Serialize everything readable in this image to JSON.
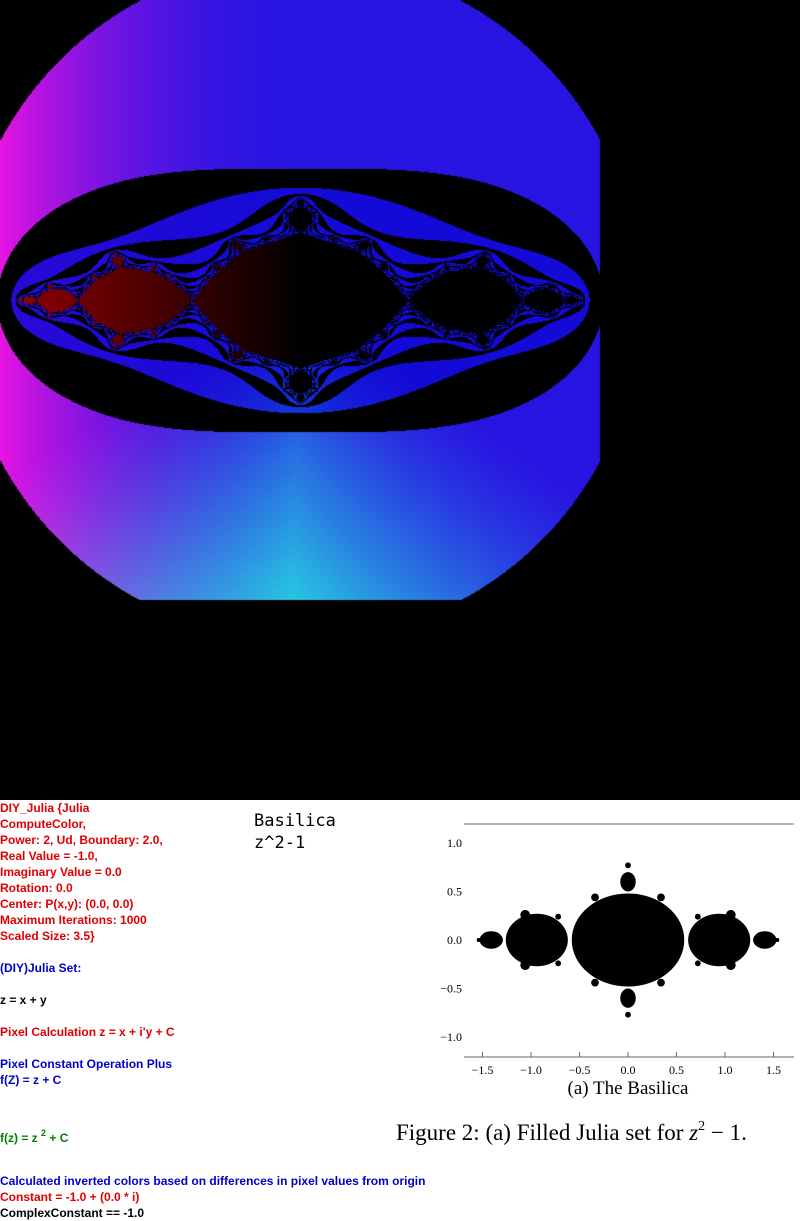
{
  "render": {
    "real": -1.0,
    "imaginary": 0.0,
    "max_iterations": 1000,
    "boundary": 2.0
  },
  "info": {
    "block1": [
      "DIY_Julia {Julia",
      "ComputeColor,",
      "Power: 2, Ud, Boundary: 2.0,",
      "Real Value = -1.0,",
      "Imaginary Value = 0.0",
      "Rotation: 0.0",
      "Center: P(x,y): (0.0, 0.0)",
      "Maximum Iterations: 1000",
      "Scaled Size: 3.5}"
    ],
    "julia_set_label": "(DIY)Julia Set:",
    "z_formula": "z = x + y",
    "pixel_calc": "Pixel Calculation z = x + i'y + C",
    "pixel_constant_op": "Pixel Constant Operation Plus",
    "fz": "f(Z) = z + C",
    "fz2_prefix": "f(z) = z ",
    "fz2_exp": "2",
    "fz2_suffix": " + C",
    "inverted_colors": "Calculated inverted colors based on differences in pixel values from origin",
    "constant": "Constant = -1.0 + (0.0 * i)",
    "complex_constant": "ComplexConstant == -1.0"
  },
  "title": {
    "name": "Basilica",
    "formula": "z^2-1"
  },
  "plot": {
    "x_ticks": [
      "−1.5",
      "−1.0",
      "−0.5",
      "0.0",
      "0.5",
      "1.0",
      "1.5"
    ],
    "y_ticks": [
      "1.0",
      "0.5",
      "0.0",
      "−0.5",
      "−1.0"
    ],
    "caption": "(a) The Basilica"
  },
  "figure_caption": {
    "text": "Figure 2: (a) Filled Julia set for ",
    "math_z": "z",
    "math_exp": "2",
    "math_rest": " − 1."
  },
  "colors": {
    "red_text": "#e00000",
    "blue_text": "#0000cc",
    "green_text": "#008000"
  }
}
